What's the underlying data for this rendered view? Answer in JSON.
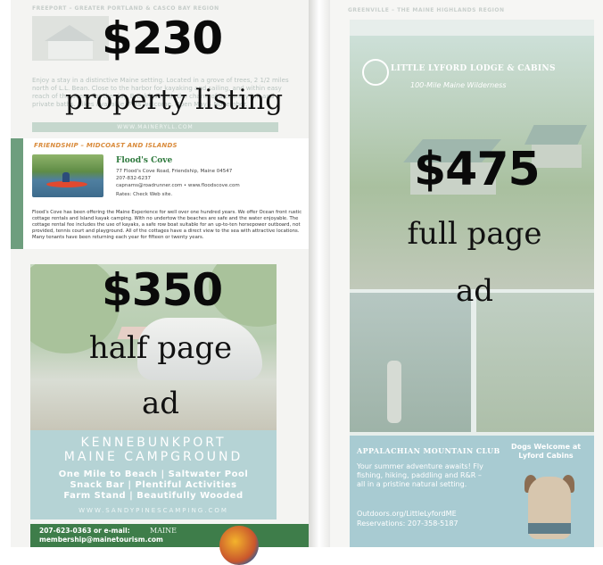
{
  "top_listing": {
    "region": "FREEPORT – GREATER PORTLAND & CASCO BAY REGION",
    "website": "WWW.MAINERYLL.COM",
    "body": "Enjoy a stay in a distinctive Maine setting. Located in a grove of trees, 2 1/2 miles north of L.L. Bean. Close to the harbor for kayaking and sailing, and within easy reach of the ocean for the day. Breakfast with the charm of a country inn and private baths. Bikes available. Pets welcome. Open May – November."
  },
  "overlay_property": {
    "price": "$230",
    "caption": "property listing"
  },
  "listing": {
    "region": "FRIENDSHIP – MIDCOAST AND ISLANDS",
    "name": "Flood's Cove",
    "address": "77 Flood's Cove Road, Friendship, Maine 04547",
    "phone": "207-832-6237",
    "email_web": "capnams@roadrunner.com • www.floodscove.com",
    "rates": "Rates: Check Web site.",
    "body": "Flood's Cove has been offering the Maine Experience for well over one hundred years. We offer Ocean front rustic cottage rentals and Island kayak camping. With no undertow the beaches are safe and the water enjoyable. The cottage rental fee includes the use of kayaks, a safe row boat suitable for an up-to-ten horsepower outboard, not provided, tennis court and playground. All of the cottages have a direct view to the sea with attractive locations. Many tenants have been returning each year for fifteen or twenty years."
  },
  "overlay_half": {
    "price": "$350",
    "caption_line1": "half page",
    "caption_line2": "ad"
  },
  "half_ad": {
    "title_line1": "KENNEBUNKPORT",
    "title_line2": "MAINE CAMPGROUND",
    "sub_line1": "One Mile to Beach | Saltwater Pool",
    "sub_line2": "Snack Bar | Plentiful Activities",
    "sub_line3": "Farm Stand | Beautifully Wooded",
    "website": "WWW.SANDYPINESCAMPING.COM"
  },
  "footer": {
    "line1": "207-623-0363 or e-mail:",
    "line2": "membership@mainetourism.com",
    "logo": "MAINE"
  },
  "right_page": {
    "region": "GREENVILLE – THE MAINE HIGHLANDS REGION",
    "brand": "LITTLE LYFORD LODGE & CABINS",
    "tagline": "100-Mile Maine Wilderness",
    "club": "APPALACHIAN MOUNTAIN CLUB",
    "pitch": "Your summer adventure awaits! Fly fishing, hiking, paddling and R&R – all in a pristine natural setting.",
    "web": "Outdoors.org/LittleLyfordME",
    "reservations": "Reservations: 207-358-5187",
    "dogs": "Dogs Welcome at Lyford Cabins"
  },
  "overlay_full": {
    "price": "$475",
    "caption_line1": "full page",
    "caption_line2": "ad"
  }
}
